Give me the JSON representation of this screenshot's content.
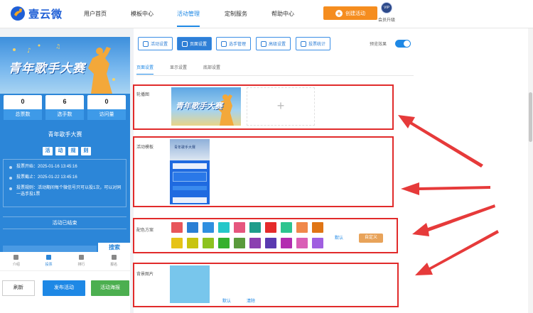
{
  "brand": {
    "name": "壹云微"
  },
  "nav": {
    "items": [
      {
        "label": "用户首页",
        "active": false
      },
      {
        "label": "模板中心",
        "active": false
      },
      {
        "label": "活动管理",
        "active": true
      },
      {
        "label": "定制服务",
        "active": false
      },
      {
        "label": "帮助中心",
        "active": false
      }
    ],
    "create_label": "创建活动",
    "vip_badge": "VIP",
    "vip_label": "会员升级"
  },
  "phone": {
    "banner_title": "青年歌手大赛",
    "stats": [
      {
        "value": "0",
        "label": "总票数"
      },
      {
        "value": "6",
        "label": "选手数"
      },
      {
        "value": "0",
        "label": "访问量"
      }
    ],
    "title": "青年歌手大赛",
    "rule_chars": [
      "活",
      "动",
      "规",
      "则"
    ],
    "rules": [
      "投票开始：2025-01-16 13:45:16",
      "投票截止：2025-01-22 13:45:16",
      "投票规则：活动期间每个微信号只可以投1次，可以对同一选手投1票"
    ],
    "ended": "活动已结束",
    "search_label": "搜索",
    "tabs": [
      {
        "label": "介绍",
        "active": false
      },
      {
        "label": "投票",
        "active": true
      },
      {
        "label": "排行",
        "active": false
      },
      {
        "label": "报名",
        "active": false
      }
    ],
    "actions": {
      "refresh": "刷新",
      "publish": "发布活动",
      "poster": "活动海报"
    }
  },
  "toolbar": {
    "buttons": [
      {
        "label": "活动设置",
        "icon": "gear-icon",
        "active": false
      },
      {
        "label": "页面设置",
        "icon": "page-icon",
        "active": true
      },
      {
        "label": "选手管理",
        "icon": "users-icon",
        "active": false
      },
      {
        "label": "高级设置",
        "icon": "advanced-icon",
        "active": false
      },
      {
        "label": "投票统计",
        "icon": "chart-icon",
        "active": false
      }
    ],
    "preview_label": "预览效果",
    "preview_on": true
  },
  "subtabs": [
    {
      "label": "页面设置",
      "active": true
    },
    {
      "label": "显示设置",
      "active": false
    },
    {
      "label": "底部设置",
      "active": false
    }
  ],
  "sections": {
    "carousel": {
      "label": "轮播图",
      "image_title": "青年歌手大赛",
      "add_symbol": "+"
    },
    "template": {
      "label": "活动模板",
      "thumb_title": "青年歌手大赛"
    },
    "colors": {
      "label": "配色方案",
      "row1": [
        "#e8565b",
        "#2a7fd4",
        "#2f8fe0",
        "#25c7c9",
        "#e6567e",
        "#1f9d8b",
        "#e52b2b",
        "#2ec48f",
        "#f0884a",
        "#e07515"
      ],
      "row2": [
        "#e6c317",
        "#c8c40f",
        "#8dc21f",
        "#35b02e",
        "#5a9a3c",
        "#8b3fb0",
        "#5a3ab0",
        "#b32cb0",
        "#d95fb6",
        "#a05fe0"
      ],
      "default_label": "默认",
      "custom_label": "自定义"
    },
    "background": {
      "label": "背景图片",
      "default_label": "默认",
      "clear_label": "清除",
      "color": "#78c6ec"
    }
  },
  "accent": "#1e88e5",
  "annotation_color": "#e12b2b"
}
